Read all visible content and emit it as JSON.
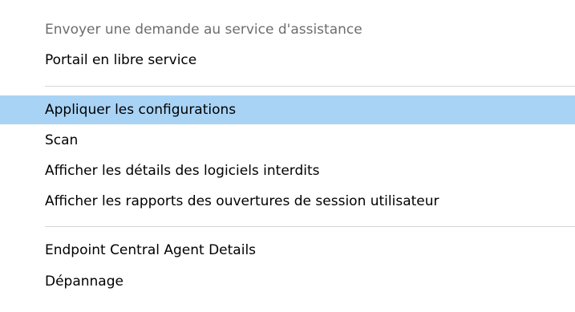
{
  "context_menu": {
    "items": [
      {
        "label": "Envoyer une demande au service d'assistance",
        "state": "disabled"
      },
      {
        "label": "Portail en libre service",
        "state": "normal"
      },
      {
        "label": "Appliquer les configurations",
        "state": "highlighted"
      },
      {
        "label": "Scan",
        "state": "normal"
      },
      {
        "label": "Afficher les détails des logiciels interdits",
        "state": "normal"
      },
      {
        "label": "Afficher les rapports des ouvertures de session utilisateur",
        "state": "normal"
      },
      {
        "label": "Endpoint Central Agent Details",
        "state": "normal"
      },
      {
        "label": "Dépannage",
        "state": "normal"
      }
    ],
    "colors": {
      "highlight": "#a9d3f5",
      "disabled_text": "#6d6d6d",
      "separator": "#d7d7d7",
      "background": "#ffffff"
    }
  }
}
